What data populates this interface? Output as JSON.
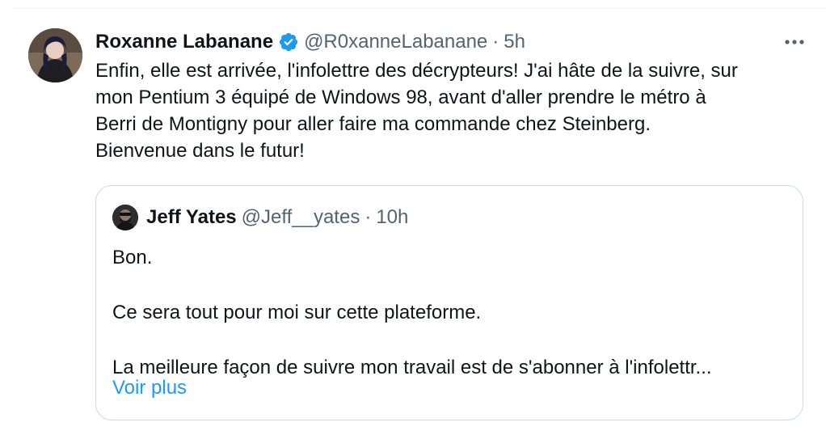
{
  "tweet": {
    "author_name": "Roxanne Labanane",
    "verified": true,
    "handle": "@R0xanneLabanane",
    "separator": "·",
    "time": "5h",
    "text_lines": [
      "Enfin, elle est arrivée, l'infolettre des décrypteurs! J'ai hâte de la suivre, sur",
      "mon Pentium 3 équipé de Windows 98, avant d'aller prendre le métro à",
      "Berri de Montigny pour aller faire ma commande chez Steinberg.",
      "Bienvenue dans le futur!"
    ],
    "more_icon": "ellipsis-icon"
  },
  "quoted": {
    "author_name": "Jeff Yates",
    "handle": "@Jeff__yates",
    "separator": "·",
    "time": "10h",
    "paragraphs": [
      "Bon.",
      "Ce sera tout pour moi sur cette plateforme.",
      "La meilleure façon de suivre mon travail est de s'abonner à l'infolettr..."
    ],
    "show_more": "Voir plus"
  },
  "colors": {
    "text": "#0f1419",
    "secondary": "#536471",
    "link": "#1d9bf0",
    "border": "#cfd9de",
    "verified": "#1d9bf0"
  }
}
